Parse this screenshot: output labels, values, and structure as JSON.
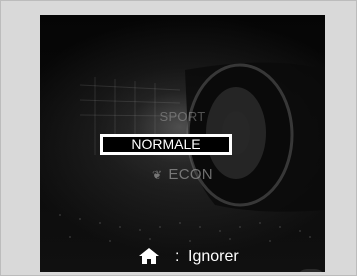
{
  "drive_mode_menu": {
    "items": [
      {
        "label": "SPORT",
        "state": "dimmed"
      },
      {
        "label": "NORMALE",
        "state": "selected"
      },
      {
        "label": "ECON",
        "state": "dimmed",
        "icon": "eco-leaf-icon"
      }
    ]
  },
  "footer": {
    "icon": "home-icon",
    "separator": ":",
    "action_label": "Ignorer"
  },
  "colors": {
    "screen_background": "#0c0c0c",
    "highlight_border": "#ffffff",
    "text": "#ffffff",
    "page_background": "#d9d9d9"
  }
}
